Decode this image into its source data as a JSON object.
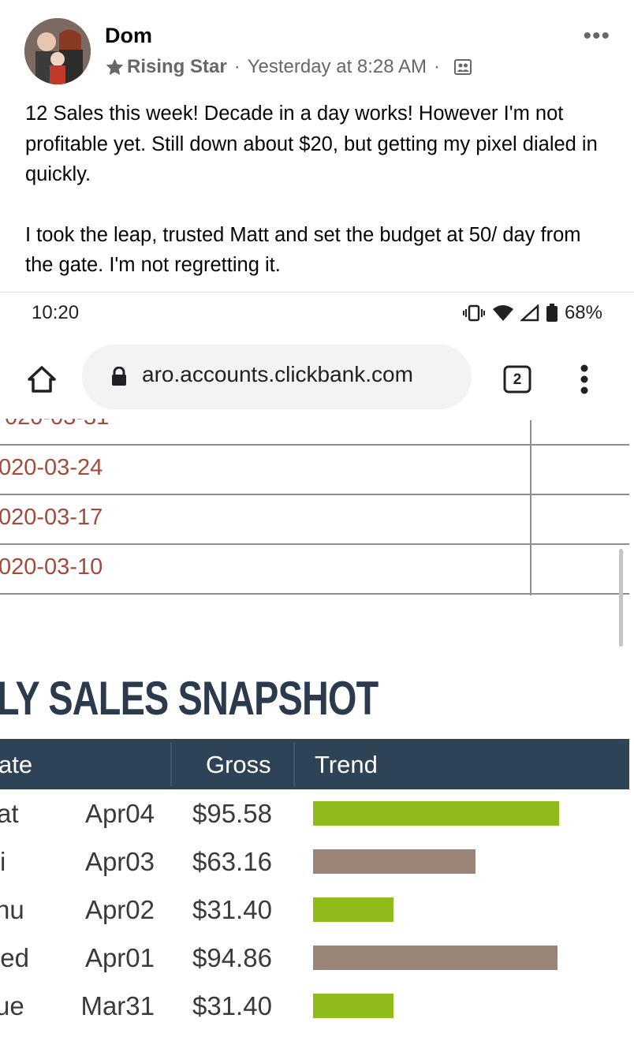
{
  "post": {
    "author": "Dom",
    "badge": "Rising Star",
    "time": "Yesterday at 8:28 AM",
    "more_label": "•••",
    "text_1": "12 Sales this week! Decade in a day works! However I'm not profitable yet. Still down about $20, but getting my pixel dialed in quickly.",
    "text_2": "I took the leap, trusted Matt and set the budget at 50/ day from the gate. I'm not regretting it."
  },
  "phone": {
    "time": "10:20",
    "battery": "68%",
    "url": "aro.accounts.clickbank.com",
    "tab_count": "2"
  },
  "dates_table": {
    "rows": [
      "020-03-24",
      "020-03-17",
      "020-03-10"
    ],
    "partial_row": "020-03-31"
  },
  "snapshot": {
    "title": "LY SALES SNAPSHOT",
    "headers": {
      "date": "ate",
      "gross": "Gross",
      "trend": "Trend"
    },
    "rows": [
      {
        "day": "at",
        "date": "Apr04",
        "gross": "$95.58",
        "value": 95.58,
        "color": "#8fbc1a"
      },
      {
        "day": "i",
        "date": "Apr03",
        "gross": "$63.16",
        "value": 63.16,
        "color": "#9a8478"
      },
      {
        "day": "nu",
        "date": "Apr02",
        "gross": "$31.40",
        "value": 31.4,
        "color": "#8fbc1a"
      },
      {
        "day": "'ed",
        "date": "Apr01",
        "gross": "$94.86",
        "value": 94.86,
        "color": "#9a8478"
      },
      {
        "day": "ue",
        "date": "Mar31",
        "gross": "$31.40",
        "value": 31.4,
        "color": "#8fbc1a"
      }
    ]
  },
  "colors": {
    "accent_green": "#8fbc1a",
    "accent_taupe": "#9a8478",
    "header_navy": "#2e4356",
    "date_red": "#a24b3b"
  }
}
